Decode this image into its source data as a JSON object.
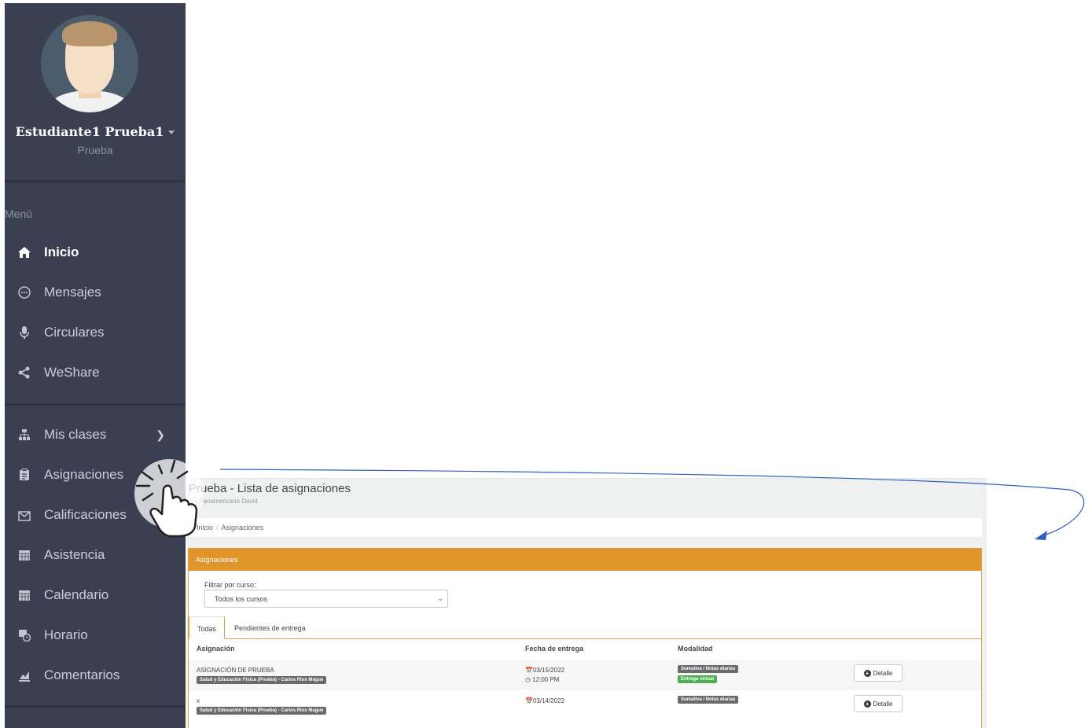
{
  "sidebar": {
    "user_name": "Estudiante1 Prueba1",
    "user_role": "Prueba",
    "menu_label": "Menú",
    "items": [
      {
        "label": "Inicio",
        "icon": "home-icon"
      },
      {
        "label": "Mensajes",
        "icon": "chat-icon"
      },
      {
        "label": "Circulares",
        "icon": "microphone-icon"
      },
      {
        "label": "WeShare",
        "icon": "share-icon"
      },
      {
        "label": "Mis clases",
        "icon": "sitemap-icon"
      },
      {
        "label": "Asignaciones",
        "icon": "clipboard-icon"
      },
      {
        "label": "Calificaciones",
        "icon": "grades-icon"
      },
      {
        "label": "Asistencia",
        "icon": "calendar-icon"
      },
      {
        "label": "Calendario",
        "icon": "calendar-icon"
      },
      {
        "label": "Horario",
        "icon": "clock-icon"
      },
      {
        "label": "Comentarios",
        "icon": "chart-icon"
      }
    ]
  },
  "page": {
    "title": "Prueba - Lista de asignaciones",
    "subtitle": "...o Panamericano David",
    "breadcrumb": {
      "home": "Inicio",
      "current": "Asignaciones"
    }
  },
  "panel": {
    "heading": "Asignaciones",
    "filter_label": "Filtrar por curso:",
    "filter_value": "Todos los cursos",
    "tabs": [
      "Todas",
      "Pendientes de entrega"
    ],
    "columns": [
      "Asignación",
      "Fecha de entrega",
      "Modalidad"
    ],
    "rows": [
      {
        "name": "ASIGNACIÓN DE PRUEBA",
        "course": "Salud y Educación Física (Prueba) - Carlos Ríos Mague",
        "date": "03/15/2022",
        "time": "12:00 PM",
        "modality": "Sumativa / Notas diarias",
        "delivery": "Entrega virtual",
        "button": "Detalle"
      },
      {
        "name": "x",
        "course": "Salud y Educación Física (Prueba) - Carlos Ríos Mague",
        "date": "03/14/2022",
        "modality": "Sumativa / Notas diarias",
        "button": "Detalle"
      }
    ]
  },
  "colors": {
    "sidebar": "#3a4051",
    "accent": "#e0952a",
    "badge_gray": "#6a6a6a",
    "badge_green": "#4caf50",
    "arrow": "#2f5fc0"
  }
}
